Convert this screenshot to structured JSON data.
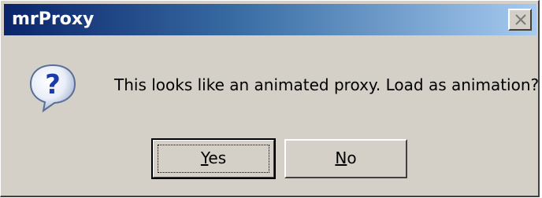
{
  "window": {
    "title": "mrProxy",
    "close_glyph": "×"
  },
  "dialog": {
    "icon": "question-icon",
    "icon_glyph": "?",
    "message": "This looks like an animated proxy. Load as animation?"
  },
  "buttons": {
    "yes": {
      "mnemonic": "Y",
      "rest": "es"
    },
    "no": {
      "mnemonic": "N",
      "rest": "o"
    }
  },
  "colors": {
    "titlebar_start": "#0a246a",
    "titlebar_end": "#a6caf0",
    "face": "#d4d0c8"
  }
}
